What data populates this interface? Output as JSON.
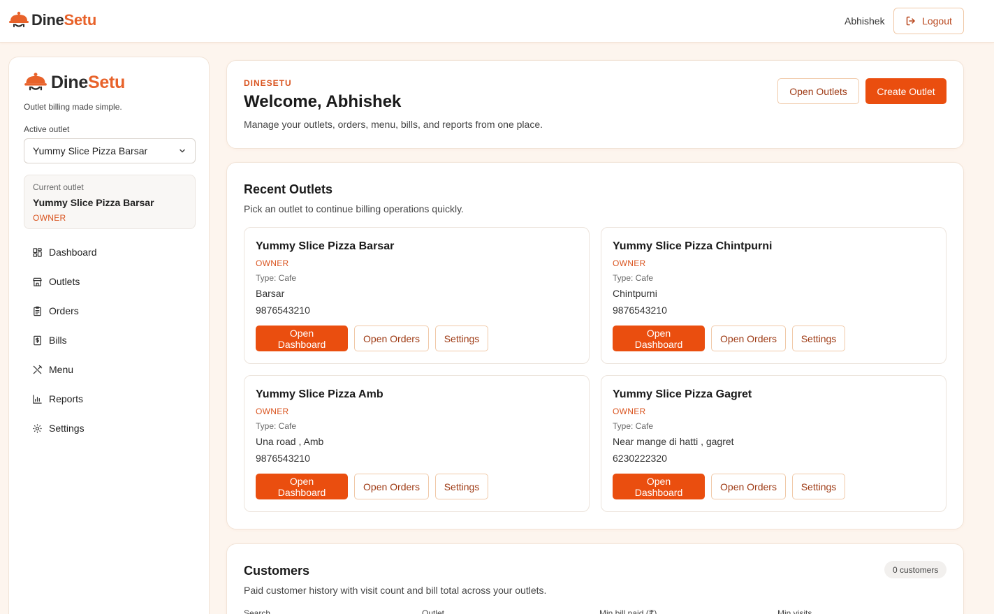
{
  "app": {
    "brand_part1": "Dine",
    "brand_part2": "Setu",
    "accent_color": "#ea4e0f"
  },
  "topbar": {
    "user_name": "Abhishek",
    "logout_label": "Logout"
  },
  "sidebar": {
    "tagline": "Outlet billing made simple.",
    "active_outlet_label": "Active outlet",
    "active_outlet_value": "Yummy Slice Pizza Barsar",
    "current_outlet_label": "Current outlet",
    "current_outlet_name": "Yummy Slice Pizza Barsar",
    "current_outlet_role": "OWNER",
    "nav": [
      {
        "label": "Dashboard",
        "icon": "dashboard-icon"
      },
      {
        "label": "Outlets",
        "icon": "store-icon"
      },
      {
        "label": "Orders",
        "icon": "clipboard-icon"
      },
      {
        "label": "Bills",
        "icon": "receipt-icon"
      },
      {
        "label": "Menu",
        "icon": "utensils-icon"
      },
      {
        "label": "Reports",
        "icon": "bar-chart-icon"
      },
      {
        "label": "Settings",
        "icon": "gear-icon"
      }
    ]
  },
  "welcome": {
    "eyebrow": "DINESETU",
    "title": "Welcome, Abhishek",
    "description": "Manage your outlets, orders, menu, bills, and reports from one place.",
    "open_outlets_label": "Open Outlets",
    "create_outlet_label": "Create Outlet"
  },
  "recent": {
    "title": "Recent Outlets",
    "description": "Pick an outlet to continue billing operations quickly.",
    "open_dashboard_label": "Open Dashboard",
    "open_orders_label": "Open Orders",
    "settings_label": "Settings",
    "outlets": [
      {
        "name": "Yummy Slice Pizza Barsar",
        "role": "OWNER",
        "type": "Type: Cafe",
        "address": "Barsar",
        "phone": "9876543210"
      },
      {
        "name": "Yummy Slice Pizza Chintpurni",
        "role": "OWNER",
        "type": "Type: Cafe",
        "address": "Chintpurni",
        "phone": "9876543210"
      },
      {
        "name": "Yummy Slice Pizza Amb",
        "role": "OWNER",
        "type": "Type: Cafe",
        "address": "Una road , Amb",
        "phone": "9876543210"
      },
      {
        "name": "Yummy Slice Pizza Gagret",
        "role": "OWNER",
        "type": "Type: Cafe",
        "address": "Near mange di hatti , gagret",
        "phone": "6230222320"
      }
    ]
  },
  "customers": {
    "title": "Customers",
    "description": "Paid customer history with visit count and bill total across your outlets.",
    "count_badge": "0 customers",
    "filters": [
      "Search",
      "Outlet",
      "Min bill paid (₹)",
      "Min visits"
    ]
  }
}
